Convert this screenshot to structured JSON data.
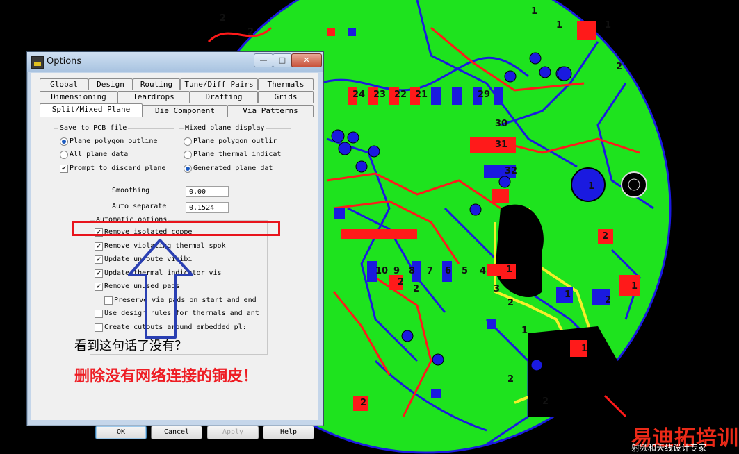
{
  "window": {
    "title": "Options",
    "minimize": "—",
    "maximize": "□",
    "close": "✕",
    "app_icon": "pads-logo-icon"
  },
  "tabs": {
    "row1": [
      "Global",
      "Design",
      "Routing",
      "Tune/Diff Pairs",
      "Thermals"
    ],
    "row2": [
      "Dimensioning",
      "Teardrops",
      "Drafting",
      "Grids"
    ],
    "row3": [
      "Split/Mixed Plane",
      "Die Component",
      "Via Patterns"
    ]
  },
  "save_group": {
    "title": "Save to PCB file",
    "options": [
      {
        "label": "Plane polygon outline",
        "selected": true
      },
      {
        "label": "All plane data",
        "selected": false
      }
    ],
    "prompt": {
      "label": "Prompt to discard plane",
      "checked": true
    }
  },
  "mixed_group": {
    "title": "Mixed plane display",
    "options": [
      {
        "label": "Plane polygon outlir",
        "selected": false
      },
      {
        "label": "Plane thermal indicat",
        "selected": false
      },
      {
        "label": "Generated plane dat",
        "selected": true
      }
    ]
  },
  "fields": {
    "smoothing_label": "Smoothing",
    "smoothing_value": "0.00",
    "auto_sep_label": "Auto separate",
    "auto_sep_value": "0.1524"
  },
  "auto_group": {
    "title": "Automatic options",
    "items": [
      {
        "label": "Remove isolated coppe",
        "checked": true
      },
      {
        "label": "Remove violating thermal spok",
        "checked": true
      },
      {
        "label": "Update unroute visibi",
        "checked": true
      },
      {
        "label": "Update thermal indicator vis",
        "checked": true
      },
      {
        "label": "Remove unused pads",
        "checked": true
      },
      {
        "label": "Preserve via pads on start and end",
        "checked": false
      },
      {
        "label": "Use design rules for thermals and ant",
        "checked": false
      },
      {
        "label": "Create cutouts around embedded pl:",
        "checked": false
      }
    ]
  },
  "buttons": {
    "ok": "OK",
    "cancel": "Cancel",
    "apply": "Apply",
    "help": "Help"
  },
  "annotation": {
    "question": "看到这句话了没有？",
    "note": "删除没有网络连接的铜皮！",
    "highlight_color": "#e8141c"
  },
  "watermark": {
    "title": "易迪拓培训",
    "subtitle": "射频和天线设计专家"
  },
  "pcb": {
    "board_color": "#1ee31e",
    "trace_colors": {
      "top": "#ff1a1a",
      "bottom": "#1a1ae0",
      "highlight": "#f5ef2a"
    },
    "pad_labels": [
      "24",
      "23",
      "22",
      "21",
      "29",
      "30",
      "31",
      "32",
      "1",
      "2",
      "2",
      "2",
      "1",
      "2",
      "1",
      "2",
      "2",
      "1",
      "2",
      "1",
      "10",
      "9",
      "8",
      "7",
      "6",
      "5",
      "4",
      "3",
      "2",
      "1",
      "1",
      "1",
      "1",
      "2",
      "2",
      "2"
    ]
  }
}
